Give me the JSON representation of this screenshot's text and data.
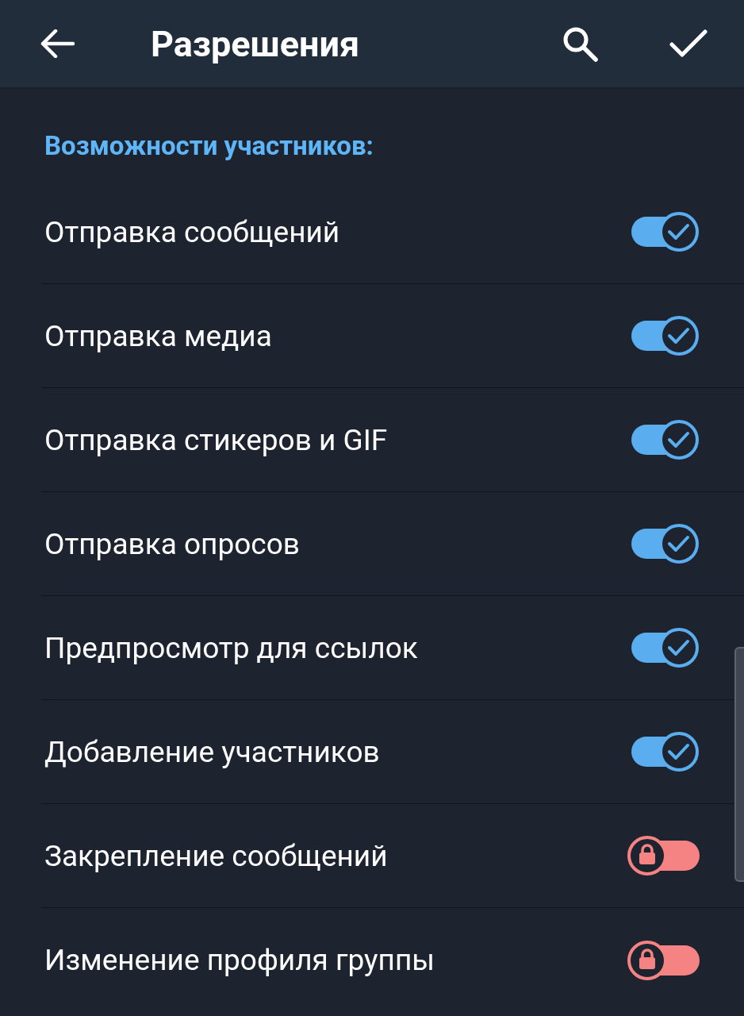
{
  "header": {
    "title": "Разрешения"
  },
  "section": {
    "title": "Возможности участников:"
  },
  "permissions": [
    {
      "label": "Отправка сообщений",
      "on": true
    },
    {
      "label": "Отправка медиа",
      "on": true
    },
    {
      "label": "Отправка стикеров и GIF",
      "on": true
    },
    {
      "label": "Отправка опросов",
      "on": true
    },
    {
      "label": "Предпросмотр для ссылок",
      "on": true
    },
    {
      "label": "Добавление участников",
      "on": true
    },
    {
      "label": "Закрепление сообщений",
      "on": false
    },
    {
      "label": "Изменение профиля группы",
      "on": false
    }
  ]
}
